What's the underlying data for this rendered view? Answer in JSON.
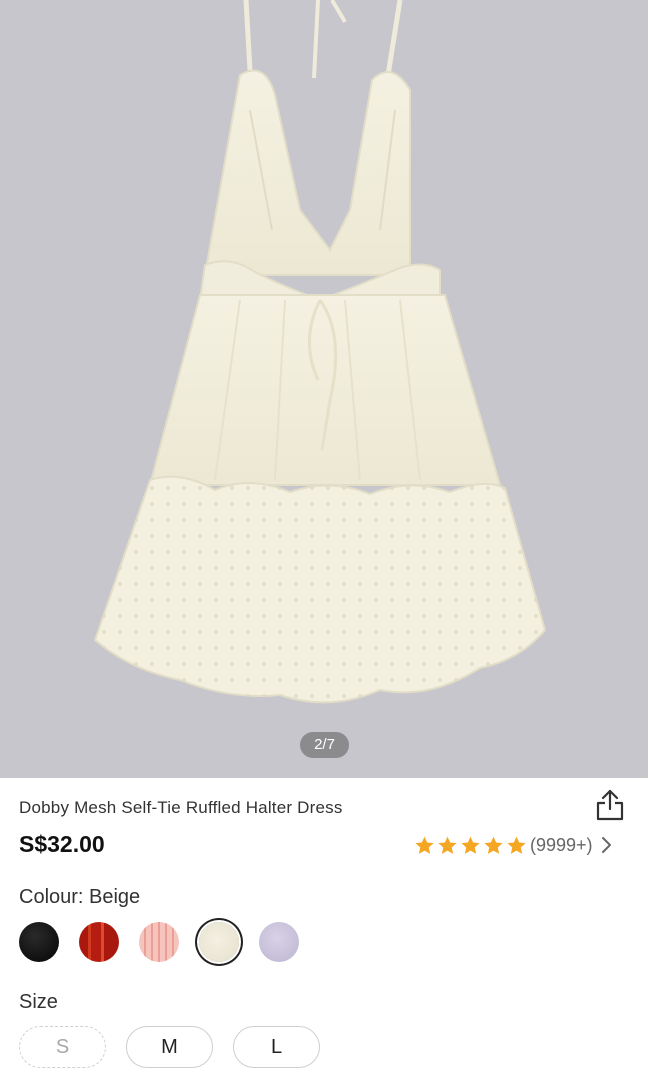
{
  "gallery": {
    "page_indicator": "2/7",
    "image_alt": "Cream halter dress back view"
  },
  "product": {
    "title": "Dobby Mesh Self-Tie Ruffled Halter Dress",
    "price": "S$32.00",
    "rating": {
      "stars": 5,
      "count_label": "(9999+)",
      "star_color": "#f5a623"
    }
  },
  "colour": {
    "label": "Colour: Beige",
    "selected": "Beige",
    "swatches": [
      {
        "name": "black",
        "color": "#111111"
      },
      {
        "name": "red",
        "color": "#b51d12"
      },
      {
        "name": "pink-stripe",
        "color": "#f2b3ab"
      },
      {
        "name": "beige",
        "color": "#efeadb",
        "selected": true
      },
      {
        "name": "lavender",
        "color": "#cac3dd"
      }
    ]
  },
  "size": {
    "label": "Size",
    "options": [
      {
        "label": "S",
        "available": false
      },
      {
        "label": "M",
        "available": true
      },
      {
        "label": "L",
        "available": true
      }
    ]
  },
  "icons": {
    "share": "share-icon",
    "chevron": "chevron-right-icon",
    "star": "star-icon"
  }
}
